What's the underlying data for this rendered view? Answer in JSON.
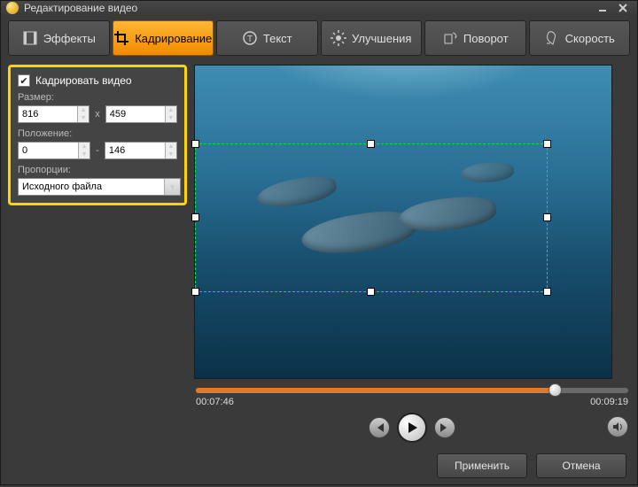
{
  "window": {
    "title": "Редактирование видео"
  },
  "tabs": {
    "effects": "Эффекты",
    "crop": "Кадрирование",
    "text": "Текст",
    "enhance": "Улучшения",
    "rotate": "Поворот",
    "speed": "Скорость"
  },
  "panel": {
    "crop_checkbox_label": "Кадрировать видео",
    "size_label": "Размер:",
    "size_w": "816",
    "size_h": "459",
    "size_sep": "x",
    "pos_label": "Положение:",
    "pos_x": "0",
    "pos_y": "146",
    "pos_sep": "-",
    "aspect_label": "Пропорции:",
    "aspect_value": "Исходного файла"
  },
  "player": {
    "current_time": "00:07:46",
    "total_time": "00:09:19"
  },
  "footer": {
    "apply": "Применить",
    "cancel": "Отмена"
  }
}
